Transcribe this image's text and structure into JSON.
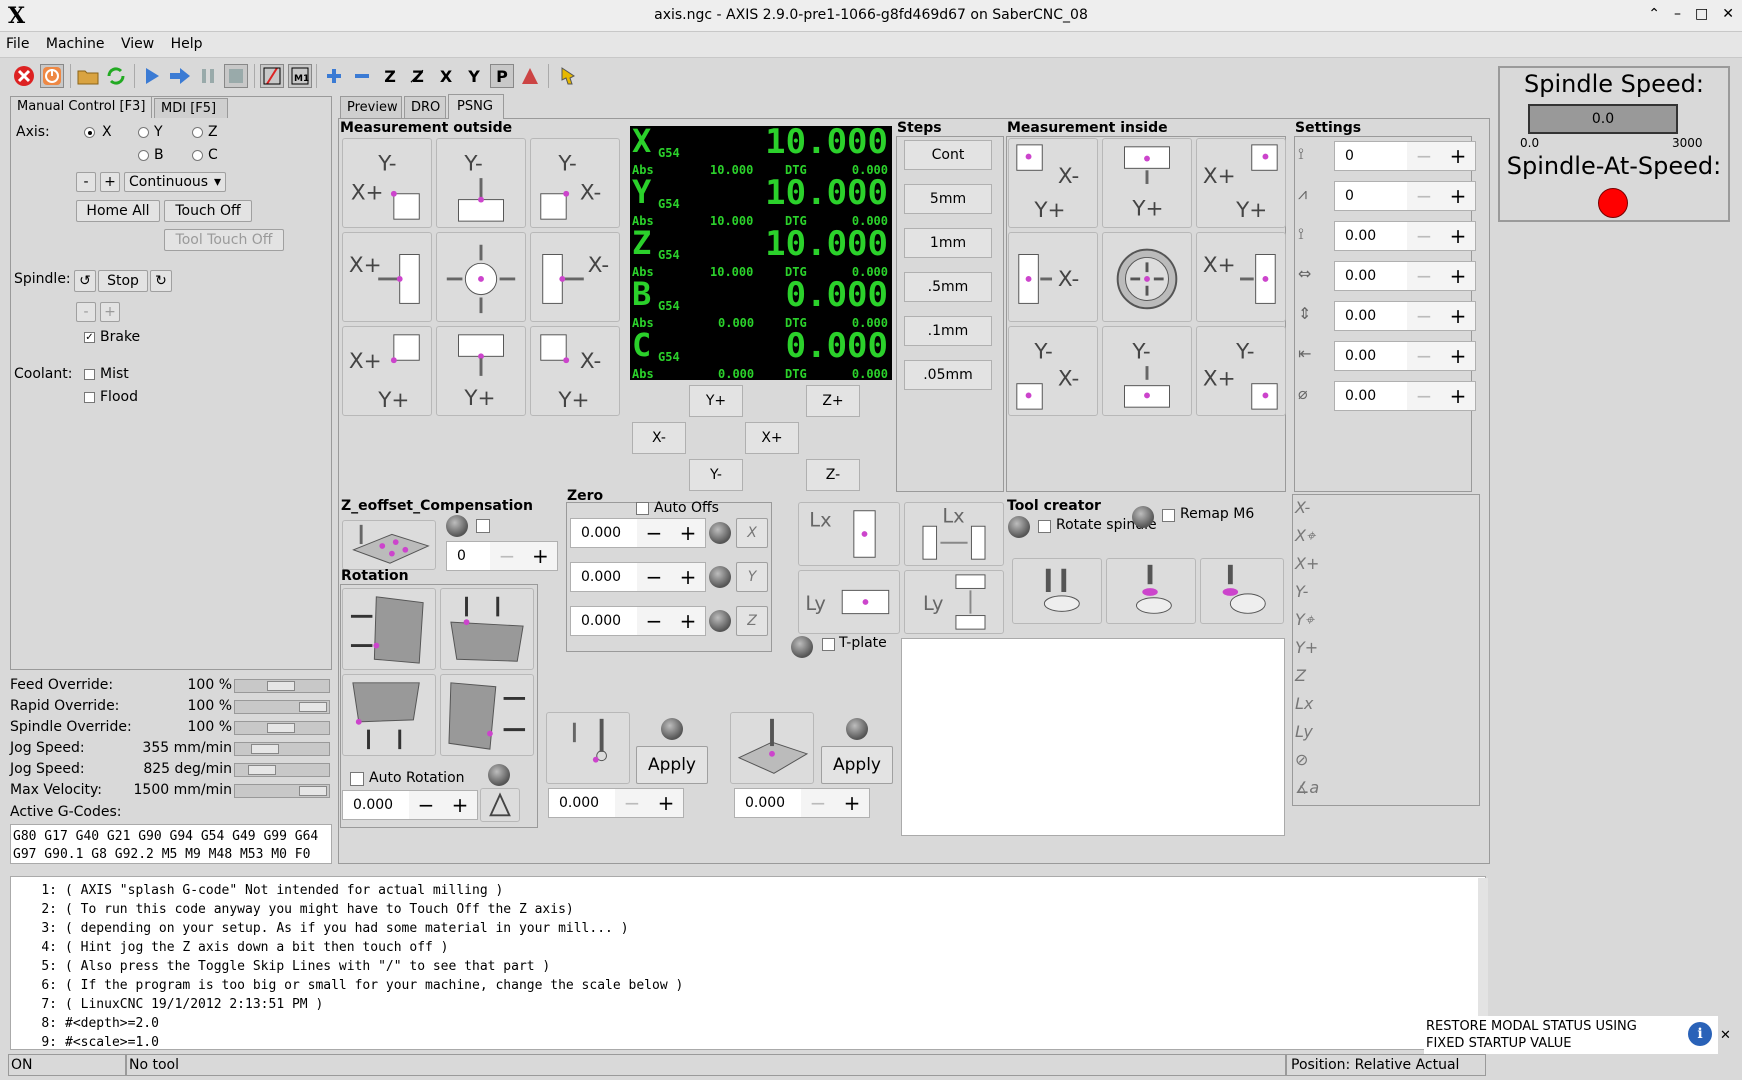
{
  "window": {
    "title": "axis.ngc - AXIS 2.9.0-pre1-1066-g8fd469d67 on SaberCNC_08",
    "logo": "X"
  },
  "menu": [
    "File",
    "Machine",
    "View",
    "Help"
  ],
  "tabs_left": [
    "Manual Control [F3]",
    "MDI [F5]"
  ],
  "tabs_right": [
    "Preview",
    "DRO",
    "PSNG"
  ],
  "manual": {
    "axis_label": "Axis:",
    "axes": [
      "X",
      "Y",
      "Z",
      "B",
      "C"
    ],
    "selected_axis": "X",
    "jog_minus": "-",
    "jog_plus": "+",
    "jog_mode": "Continuous",
    "home_all": "Home All",
    "touch_off": "Touch Off",
    "tool_touch_off": "Tool Touch Off",
    "spindle_label": "Spindle:",
    "spindle_stop": "Stop",
    "spindle_minus": "-",
    "spindle_plus": "+",
    "brake": "Brake",
    "coolant_label": "Coolant:",
    "mist": "Mist",
    "flood": "Flood"
  },
  "overrides": [
    {
      "label": "Feed Override:",
      "value": "100 %",
      "fraction": 0.5
    },
    {
      "label": "Rapid Override:",
      "value": "100 %",
      "fraction": 1.0
    },
    {
      "label": "Spindle Override:",
      "value": "100 %",
      "fraction": 0.5
    },
    {
      "label": "Jog Speed:",
      "value": "355 mm/min",
      "fraction": 0.25
    },
    {
      "label": "Jog Speed:",
      "value": "825 deg/min",
      "fraction": 0.2
    },
    {
      "label": "Max Velocity:",
      "value": "1500 mm/min",
      "fraction": 1.0
    }
  ],
  "gcodes": {
    "label": "Active G-Codes:",
    "line1": "G80 G17 G40 G21 G90 G94 G54 G49 G99 G64",
    "line2": "G97 G90.1 G8 G92.2 M5 M9 M48 M53 M0 F0"
  },
  "psng": {
    "meas_outside": "Measurement outside",
    "meas_inside": "Measurement inside",
    "steps_title": "Steps",
    "steps": [
      "Cont",
      "5mm",
      "1mm",
      ".5mm",
      ".1mm",
      ".05mm"
    ],
    "settings_title": "Settings",
    "settings_values": [
      "0",
      "0",
      "0.00",
      "0.00",
      "0.00",
      "0.00",
      "0.00"
    ],
    "jog": {
      "yplus": "Y+",
      "yminus": "Y-",
      "xminus": "X-",
      "xplus": "X+",
      "zplus": "Z+",
      "zminus": "Z-"
    },
    "dro": [
      {
        "axis": "X",
        "cs": "G54",
        "value": "10.000",
        "abs_label": "Abs",
        "abs": "10.000",
        "dtg_label": "DTG",
        "dtg": "0.000"
      },
      {
        "axis": "Y",
        "cs": "G54",
        "value": "10.000",
        "abs_label": "Abs",
        "abs": "10.000",
        "dtg_label": "DTG",
        "dtg": "0.000"
      },
      {
        "axis": "Z",
        "cs": "G54",
        "value": "10.000",
        "abs_label": "Abs",
        "abs": "10.000",
        "dtg_label": "DTG",
        "dtg": "0.000"
      },
      {
        "axis": "B",
        "cs": "G54",
        "value": "0.000",
        "abs_label": "Abs",
        "abs": "0.000",
        "dtg_label": "DTG",
        "dtg": "0.000"
      },
      {
        "axis": "C",
        "cs": "G54",
        "value": "0.000",
        "abs_label": "Abs",
        "abs": "0.000",
        "dtg_label": "DTG",
        "dtg": "0.000"
      }
    ],
    "z_eoffset_title": "Z_eoffset_Compensation",
    "z_eoffset_value": "0",
    "zero_title": "Zero",
    "auto_offs": "Auto Offs",
    "zero_values": [
      "0.000",
      "0.000",
      "0.000"
    ],
    "zero_axes": [
      "X",
      "Y",
      "Z"
    ],
    "rotation_title": "Rotation",
    "auto_rotation": "Auto Rotation",
    "rotation_value": "0.000",
    "apply1": "Apply",
    "apply2": "Apply",
    "apply1_value": "0.000",
    "apply2_value": "0.000",
    "tplate": "T-plate",
    "tool_creator": "Tool creator",
    "rotate_spindle": "Rotate spindle",
    "remap_m6": "Remap M6",
    "side_labels": [
      "X-",
      "X⌖",
      "X+",
      "Y-",
      "Y⌖",
      "Y+",
      "Z",
      "Lx",
      "Ly",
      "⊘",
      "∡a"
    ]
  },
  "spindle_panel": {
    "speed_label": "Spindle Speed:",
    "speed_value": "0.0",
    "min": "0.0",
    "max": "3000",
    "at_speed_label": "Spindle-At-Speed:",
    "at_speed_color": "#ff0000"
  },
  "code_lines": [
    {
      "n": "1:",
      "t": "( AXIS \"splash G-code\" Not intended for actual milling )"
    },
    {
      "n": "2:",
      "t": "( To run this code anyway you might have to Touch Off the Z axis)"
    },
    {
      "n": "3:",
      "t": "( depending on your setup. As if you had some material in your mill... )"
    },
    {
      "n": "4:",
      "t": "( Hint jog the Z axis down a bit then touch off )"
    },
    {
      "n": "5:",
      "t": "( Also press the Toggle Skip Lines with \"/\" to see that part )"
    },
    {
      "n": "6:",
      "t": "( If the program is too big or small for your machine, change the scale below )"
    },
    {
      "n": "7:",
      "t": "( LinuxCNC 19/1/2012 2:13:51 PM )"
    },
    {
      "n": "8:",
      "t": "#<depth>=2.0"
    },
    {
      "n": "9:",
      "t": "#<scale>=1.0"
    }
  ],
  "status": {
    "state": "ON",
    "tool": "No tool",
    "position": "Position: Relative Actual"
  },
  "notice": {
    "text": "RESTORE MODAL STATUS USING FIXED STARTUP VALUE",
    "icon": "info-icon"
  }
}
